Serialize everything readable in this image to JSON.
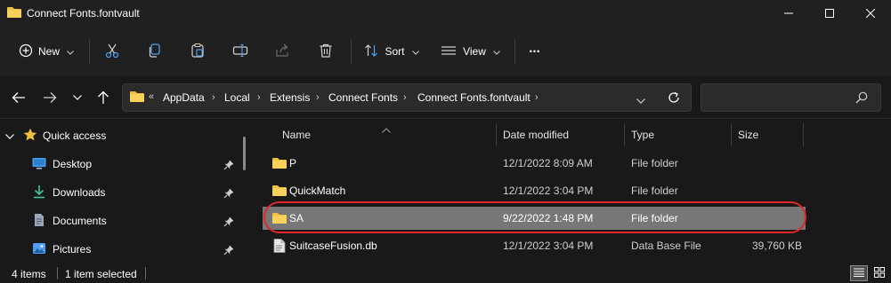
{
  "window": {
    "title": "Connect Fonts.fontvault",
    "minimize_glyph": "—",
    "maximize_glyph": "☐",
    "close_glyph": "✕"
  },
  "toolbar": {
    "new_label": "New",
    "sort_label": "Sort",
    "view_label": "View",
    "more_glyph": "•••"
  },
  "address": {
    "overflow": "«",
    "crumbs": [
      "AppData",
      "Local",
      "Extensis",
      "Connect Fonts",
      "Connect Fonts.fontvault"
    ],
    "sep": "›",
    "dropdown_glyph": "⌄",
    "refresh_glyph": "↻"
  },
  "search": {
    "placeholder": ""
  },
  "navpane": {
    "quick_access": "Quick access",
    "items": [
      {
        "label": "Desktop"
      },
      {
        "label": "Downloads"
      },
      {
        "label": "Documents"
      },
      {
        "label": "Pictures"
      }
    ]
  },
  "columns": {
    "name": "Name",
    "date": "Date modified",
    "type": "Type",
    "size": "Size"
  },
  "files": [
    {
      "name": "P",
      "date": "12/1/2022 8:09 AM",
      "type": "File folder",
      "size": "",
      "kind": "folder",
      "selected": false
    },
    {
      "name": "QuickMatch",
      "date": "12/1/2022 3:04 PM",
      "type": "File folder",
      "size": "",
      "kind": "folder",
      "selected": false
    },
    {
      "name": "SA",
      "date": "9/22/2022 1:48 PM",
      "type": "File folder",
      "size": "",
      "kind": "folder",
      "selected": true
    },
    {
      "name": "SuitcaseFusion.db",
      "date": "12/1/2022 3:04 PM",
      "type": "Data Base File",
      "size": "39,760 KB",
      "kind": "file",
      "selected": false
    }
  ],
  "status": {
    "items_count": "4 items",
    "selected_count": "1 item selected"
  },
  "colors": {
    "folder": "#f0c040",
    "selection": "#777777",
    "highlight_ring": "#e0262b",
    "accent_blue": "#4ca0f0"
  }
}
